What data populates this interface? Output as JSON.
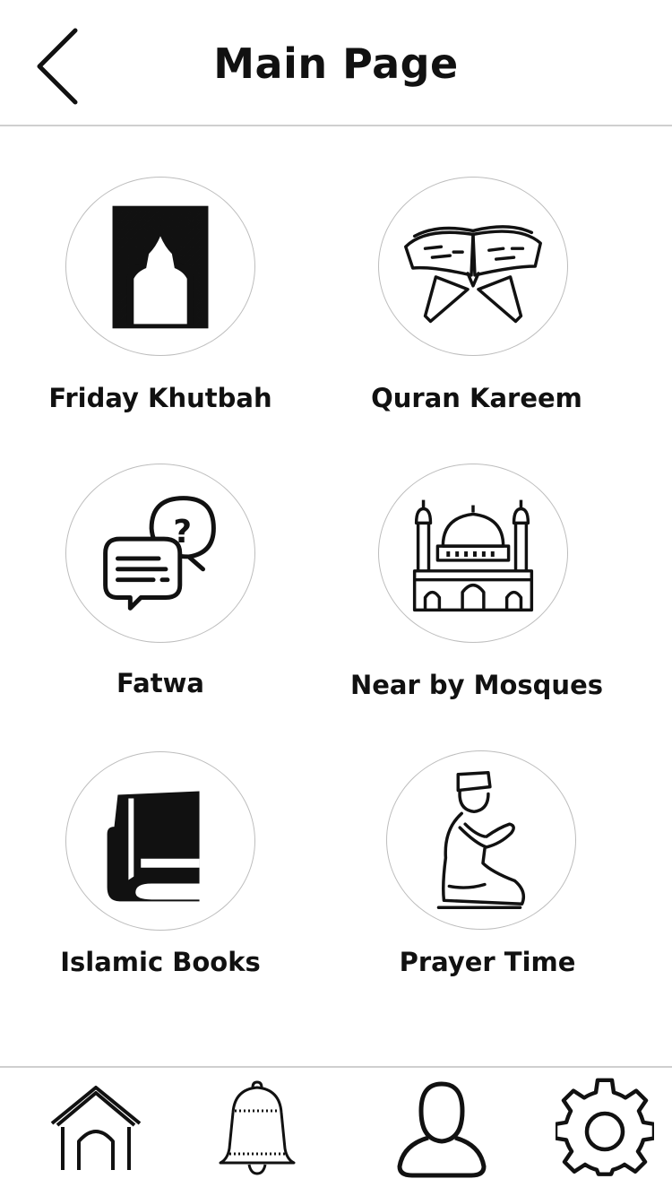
{
  "header": {
    "title": "Main Page",
    "back_icon": "chevron-left-icon"
  },
  "menu": [
    {
      "label": "Friday Khutbah",
      "icon": "mihrab-icon"
    },
    {
      "label": "Quran Kareem",
      "icon": "quran-stand-icon"
    },
    {
      "label": "Fatwa",
      "icon": "chat-question-icon"
    },
    {
      "label": "Near by Mosques",
      "icon": "mosque-icon"
    },
    {
      "label": "Islamic Books",
      "icon": "books-icon"
    },
    {
      "label": "Prayer Time",
      "icon": "praying-man-icon"
    }
  ],
  "tabbar": [
    {
      "icon": "home-icon"
    },
    {
      "icon": "bell-icon"
    },
    {
      "icon": "user-icon"
    },
    {
      "icon": "gear-icon"
    }
  ],
  "colors": {
    "line": "#cfcfcf",
    "circle_border": "#bdbdbd",
    "text": "#111111",
    "background": "#ffffff"
  }
}
